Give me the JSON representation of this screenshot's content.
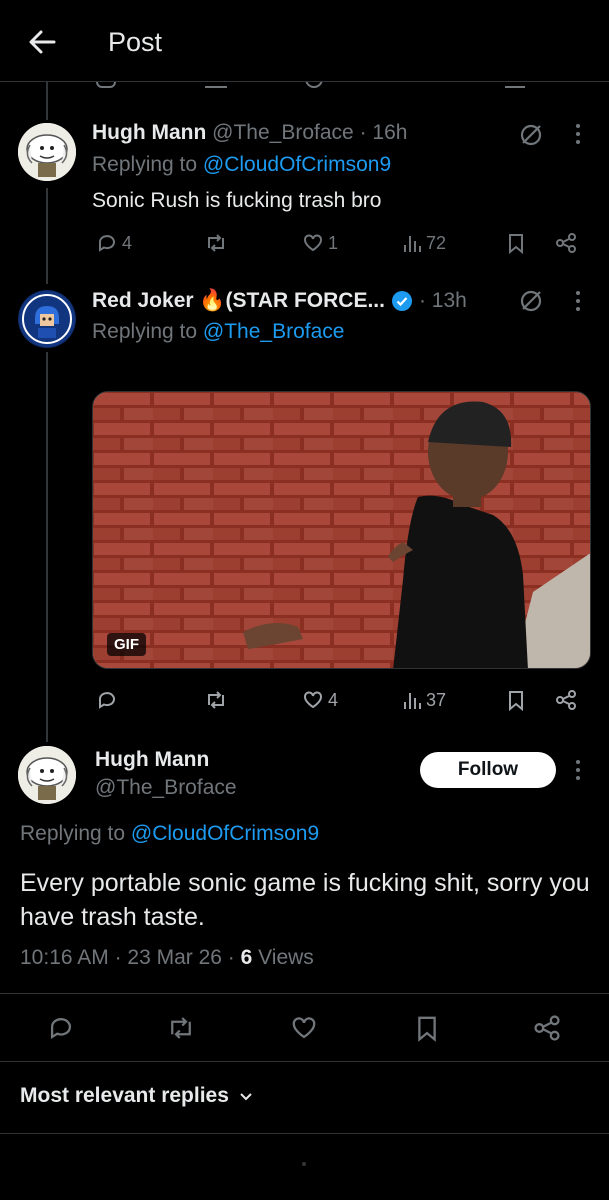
{
  "header": {
    "title": "Post"
  },
  "reply1": {
    "name": "Hugh Mann",
    "handle": "@The_Broface",
    "time": "· 16h",
    "replying_prefix": "Replying to",
    "replying_to": "@CloudOfCrimson9",
    "text": "Sonic Rush is fucking trash bro",
    "replies": "4",
    "likes": "1",
    "views": "72"
  },
  "reply2": {
    "name": "Red Joker 🔥(STAR FORCE...",
    "time": "· 13h",
    "replying_prefix": "Replying to",
    "replying_to": "@The_Broface",
    "gif_label": "GIF",
    "likes": "4",
    "views": "37"
  },
  "main_post": {
    "name": "Hugh Mann",
    "handle": "@The_Broface",
    "follow_label": "Follow",
    "replying_prefix": "Replying to",
    "replying_to": "@CloudOfCrimson9",
    "text": "Every portable sonic game is fucking shit, sorry you have trash taste.",
    "time": "10:16 AM",
    "date": "· 23 Mar 26 ·",
    "views_count": "6",
    "views_label": "Views"
  },
  "replies_sort": {
    "label": "Most relevant replies"
  },
  "colors": {
    "background": "#000000",
    "link": "#1d9bf0",
    "muted": "#71767b",
    "text": "#e7e9ea",
    "verified": "#1d9bf0"
  }
}
